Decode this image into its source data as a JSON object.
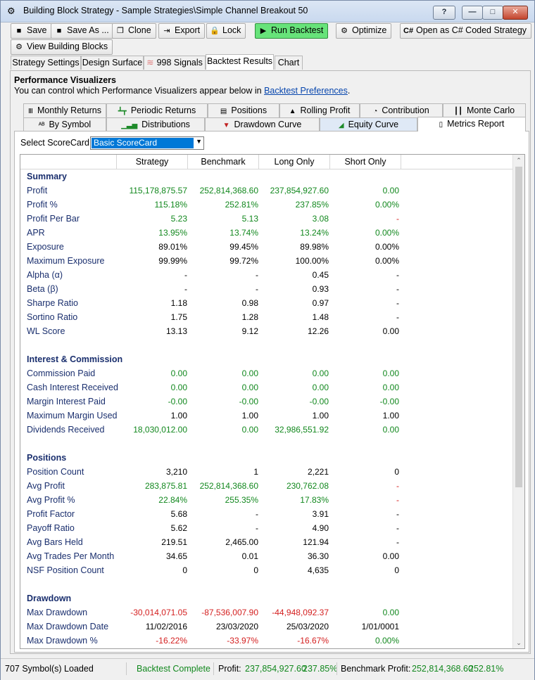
{
  "window": {
    "title": "Building Block Strategy - Sample Strategies\\Simple Channel Breakout 50",
    "app_icon": "building-blocks-icon",
    "buttons": {
      "help": "?",
      "minimize": "—",
      "maximize": "□",
      "close": "✕"
    }
  },
  "toolbar": {
    "save": "Save",
    "save_as": "Save As ...",
    "clone": "Clone",
    "export": "Export",
    "lock": "Lock",
    "run_backtest": "Run Backtest",
    "optimize": "Optimize",
    "open_csharp": "Open as C# Coded Strategy",
    "csharp_icon_text": "C#",
    "view_building_blocks": "View Building Blocks"
  },
  "tabs": [
    "Strategy Settings",
    "Design Surface",
    "998 Signals",
    "Backtest Results",
    "Chart"
  ],
  "active_tab": "Backtest Results",
  "performance": {
    "title": "Performance Visualizers",
    "subtitle_prefix": "You can control which Performance Visualizers appear below in ",
    "subtitle_link": "Backtest Preferences",
    "subtitle_suffix": "."
  },
  "visualizer_tabs_row1": [
    "Monthly Returns",
    "Periodic Returns",
    "Positions",
    "Rolling Profit",
    "Contribution",
    "Monte Carlo"
  ],
  "visualizer_tabs_row2": [
    "By Symbol",
    "Distributions",
    "Drawdown Curve",
    "Equity Curve",
    "Metrics Report"
  ],
  "active_visualizer": "Metrics Report",
  "scorecard": {
    "label": "Select ScoreCard:",
    "value": "Basic ScoreCard"
  },
  "columns": [
    "Strategy",
    "Benchmark",
    "Long Only",
    "Short Only"
  ],
  "colors": {
    "positive": "#12881e",
    "negative": "#d42020",
    "neutral": "#000000",
    "label": "#1a2f6e",
    "run_button": "#67e37a"
  },
  "sections": [
    {
      "name": "Summary",
      "rows": [
        {
          "label": "Profit",
          "values": [
            "115,178,875.57",
            "252,814,368.60",
            "237,854,927.60",
            "0.00"
          ],
          "colors": [
            "g",
            "g",
            "g",
            "g"
          ]
        },
        {
          "label": "Profit %",
          "values": [
            "115.18%",
            "252.81%",
            "237.85%",
            "0.00%"
          ],
          "colors": [
            "g",
            "g",
            "g",
            "g"
          ]
        },
        {
          "label": "Profit Per Bar",
          "values": [
            "5.23",
            "5.13",
            "3.08",
            "-"
          ],
          "colors": [
            "g",
            "g",
            "g",
            "r"
          ]
        },
        {
          "label": "APR",
          "values": [
            "13.95%",
            "13.74%",
            "13.24%",
            "0.00%"
          ],
          "colors": [
            "g",
            "g",
            "g",
            "g"
          ]
        },
        {
          "label": "Exposure",
          "values": [
            "89.01%",
            "99.45%",
            "89.98%",
            "0.00%"
          ],
          "colors": [
            "k",
            "k",
            "k",
            "k"
          ]
        },
        {
          "label": "Maximum Exposure",
          "values": [
            "99.99%",
            "99.72%",
            "100.00%",
            "0.00%"
          ],
          "colors": [
            "k",
            "k",
            "k",
            "k"
          ]
        },
        {
          "label": "Alpha (α)",
          "values": [
            "-",
            "-",
            "0.45",
            "-"
          ],
          "colors": [
            "k",
            "k",
            "k",
            "k"
          ]
        },
        {
          "label": "Beta (β)",
          "values": [
            "-",
            "-",
            "0.93",
            "-"
          ],
          "colors": [
            "k",
            "k",
            "k",
            "k"
          ]
        },
        {
          "label": "Sharpe Ratio",
          "values": [
            "1.18",
            "0.98",
            "0.97",
            "-"
          ],
          "colors": [
            "k",
            "k",
            "k",
            "k"
          ]
        },
        {
          "label": "Sortino Ratio",
          "values": [
            "1.75",
            "1.28",
            "1.48",
            "-"
          ],
          "colors": [
            "k",
            "k",
            "k",
            "k"
          ]
        },
        {
          "label": "WL Score",
          "values": [
            "13.13",
            "9.12",
            "12.26",
            "0.00"
          ],
          "colors": [
            "k",
            "k",
            "k",
            "k"
          ]
        }
      ]
    },
    {
      "name": "Interest & Commission",
      "rows": [
        {
          "label": "Commission Paid",
          "values": [
            "0.00",
            "0.00",
            "0.00",
            "0.00"
          ],
          "colors": [
            "g",
            "g",
            "g",
            "g"
          ]
        },
        {
          "label": "Cash Interest Received",
          "values": [
            "0.00",
            "0.00",
            "0.00",
            "0.00"
          ],
          "colors": [
            "g",
            "g",
            "g",
            "g"
          ]
        },
        {
          "label": "Margin Interest Paid",
          "values": [
            "-0.00",
            "-0.00",
            "-0.00",
            "-0.00"
          ],
          "colors": [
            "g",
            "g",
            "g",
            "g"
          ]
        },
        {
          "label": "Maximum Margin Used",
          "values": [
            "1.00",
            "1.00",
            "1.00",
            "1.00"
          ],
          "colors": [
            "k",
            "k",
            "k",
            "k"
          ]
        },
        {
          "label": "Dividends Received",
          "values": [
            "18,030,012.00",
            "0.00",
            "32,986,551.92",
            "0.00"
          ],
          "colors": [
            "g",
            "g",
            "g",
            "g"
          ]
        }
      ]
    },
    {
      "name": "Positions",
      "rows": [
        {
          "label": "Position Count",
          "values": [
            "3,210",
            "1",
            "2,221",
            "0"
          ],
          "colors": [
            "k",
            "k",
            "k",
            "k"
          ]
        },
        {
          "label": "Avg Profit",
          "values": [
            "283,875.81",
            "252,814,368.60",
            "230,762.08",
            "-"
          ],
          "colors": [
            "g",
            "g",
            "g",
            "r"
          ]
        },
        {
          "label": "Avg Profit %",
          "values": [
            "22.84%",
            "255.35%",
            "17.83%",
            "-"
          ],
          "colors": [
            "g",
            "g",
            "g",
            "r"
          ]
        },
        {
          "label": "Profit Factor",
          "values": [
            "5.68",
            "-",
            "3.91",
            "-"
          ],
          "colors": [
            "k",
            "k",
            "k",
            "k"
          ]
        },
        {
          "label": "Payoff Ratio",
          "values": [
            "5.62",
            "-",
            "4.90",
            "-"
          ],
          "colors": [
            "k",
            "k",
            "k",
            "k"
          ]
        },
        {
          "label": "Avg Bars Held",
          "values": [
            "219.51",
            "2,465.00",
            "121.94",
            "-"
          ],
          "colors": [
            "k",
            "k",
            "k",
            "k"
          ]
        },
        {
          "label": "Avg Trades Per Month",
          "values": [
            "34.65",
            "0.01",
            "36.30",
            "0.00"
          ],
          "colors": [
            "k",
            "k",
            "k",
            "k"
          ]
        },
        {
          "label": "NSF Position Count",
          "values": [
            "0",
            "0",
            "4,635",
            "0"
          ],
          "colors": [
            "k",
            "k",
            "k",
            "k"
          ]
        }
      ]
    },
    {
      "name": "Drawdown",
      "rows": [
        {
          "label": "Max Drawdown",
          "values": [
            "-30,014,071.05",
            "-87,536,007.90",
            "-44,948,092.37",
            "0.00"
          ],
          "colors": [
            "r",
            "r",
            "r",
            "g"
          ]
        },
        {
          "label": "Max Drawdown Date",
          "values": [
            "11/02/2016",
            "23/03/2020",
            "25/03/2020",
            "1/01/0001"
          ],
          "colors": [
            "k",
            "k",
            "k",
            "k"
          ]
        },
        {
          "label": "Max Drawdown %",
          "values": [
            "-16.22%",
            "-33.97%",
            "-16.67%",
            "0.00%"
          ],
          "colors": [
            "r",
            "r",
            "r",
            "g"
          ]
        }
      ]
    }
  ],
  "status": {
    "symbols": "707 Symbol(s) Loaded",
    "backtest": "Backtest Complete",
    "profit_label": "Profit:",
    "profit_value": "237,854,927.60",
    "profit_pct": "237.85%",
    "benchmark_label": "Benchmark Profit:",
    "benchmark_value": "252,814,368.60",
    "benchmark_pct": "252.81%"
  }
}
